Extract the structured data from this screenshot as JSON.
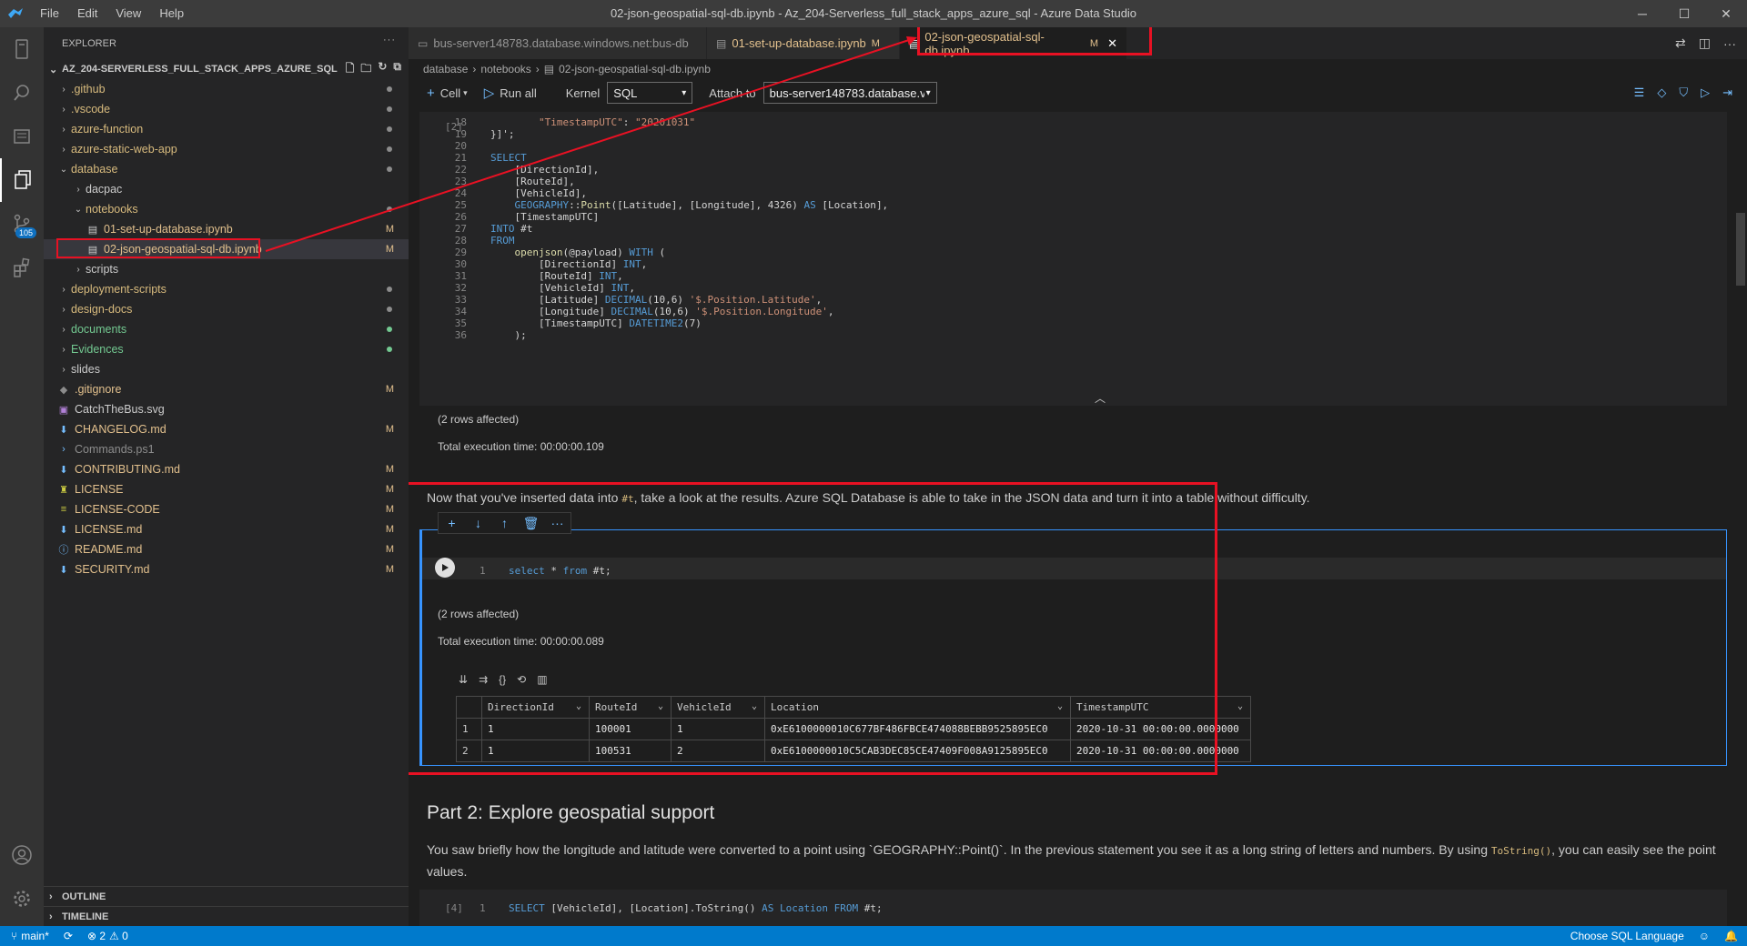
{
  "window": {
    "title": "02-json-geospatial-sql-db.ipynb - Az_204-Serverless_full_stack_apps_azure_sql - Azure Data Studio",
    "menu": [
      "File",
      "Edit",
      "View",
      "Help"
    ],
    "controls": {
      "minimize": "─",
      "maximize": "☐",
      "close": "✕"
    }
  },
  "activity_bar": {
    "items": [
      "connections-icon",
      "search-icon",
      "notebooks-icon",
      "explorer-icon",
      "source-control-icon",
      "extensions-icon",
      "account-icon",
      "settings-icon"
    ],
    "scm_badge": "105"
  },
  "sidebar": {
    "header": "EXPLORER",
    "more": "···",
    "root": "AZ_204-SERVERLESS_FULL_STACK_APPS_AZURE_SQL",
    "items": [
      {
        "label": ".github",
        "status": "dot"
      },
      {
        "label": ".vscode",
        "status": "dot"
      },
      {
        "label": "azure-function",
        "status": "dot"
      },
      {
        "label": "azure-static-web-app",
        "status": "dot"
      },
      {
        "label": "database",
        "status": "dot"
      },
      {
        "label": "dacpac",
        "status": ""
      },
      {
        "label": "notebooks",
        "status": "dot"
      },
      {
        "label": "01-set-up-database.ipynb",
        "status": "M"
      },
      {
        "label": "02-json-geospatial-sql-db.ipynb",
        "status": "M"
      },
      {
        "label": "scripts",
        "status": ""
      },
      {
        "label": "deployment-scripts",
        "status": "dot"
      },
      {
        "label": "design-docs",
        "status": "dot"
      },
      {
        "label": "documents",
        "status": "dot"
      },
      {
        "label": "Evidences",
        "status": "dot"
      },
      {
        "label": "slides",
        "status": ""
      },
      {
        "label": ".gitignore",
        "status": "M"
      },
      {
        "label": "CatchTheBus.svg",
        "status": ""
      },
      {
        "label": "CHANGELOG.md",
        "status": "M"
      },
      {
        "label": "Commands.ps1",
        "status": ""
      },
      {
        "label": "CONTRIBUTING.md",
        "status": "M"
      },
      {
        "label": "LICENSE",
        "status": "M"
      },
      {
        "label": "LICENSE-CODE",
        "status": "M"
      },
      {
        "label": "LICENSE.md",
        "status": "M"
      },
      {
        "label": "README.md",
        "status": "M"
      },
      {
        "label": "SECURITY.md",
        "status": "M"
      }
    ],
    "outline": "OUTLINE",
    "timeline": "TIMELINE"
  },
  "tabs": [
    {
      "label": "bus-server148783.database.windows.net:bus-db",
      "modified": ""
    },
    {
      "label": "01-set-up-database.ipynb",
      "modified": "M"
    },
    {
      "label": "02-json-geospatial-sql-db.ipynb",
      "modified": "M",
      "close": "✕"
    }
  ],
  "breadcrumb": [
    "database",
    "notebooks",
    "02-json-geospatial-sql-db.ipynb"
  ],
  "notebook_toolbar": {
    "cell": "Cell",
    "run_all": "Run all",
    "kernel_label": "Kernel",
    "kernel_value": "SQL",
    "attach_label": "Attach to",
    "attach_value": "bus-server148783.database.v"
  },
  "cell1": {
    "exec_count": "[2]",
    "lines": [
      {
        "n": "18",
        "text": "        \"TimestampUTC\": \"20201031\""
      },
      {
        "n": "19",
        "text": "}]';"
      },
      {
        "n": "20",
        "text": ""
      },
      {
        "n": "21",
        "text": "SELECT"
      },
      {
        "n": "22",
        "text": "    [DirectionId],"
      },
      {
        "n": "23",
        "text": "    [RouteId],"
      },
      {
        "n": "24",
        "text": "    [VehicleId],"
      },
      {
        "n": "25",
        "text": "    GEOGRAPHY::Point([Latitude], [Longitude], 4326) AS [Location],"
      },
      {
        "n": "26",
        "text": "    [TimestampUTC]"
      },
      {
        "n": "27",
        "text": "INTO #t"
      },
      {
        "n": "28",
        "text": "FROM"
      },
      {
        "n": "29",
        "text": "    openjson(@payload) WITH ("
      },
      {
        "n": "30",
        "text": "        [DirectionId] INT,"
      },
      {
        "n": "31",
        "text": "        [RouteId] INT,"
      },
      {
        "n": "32",
        "text": "        [VehicleId] INT,"
      },
      {
        "n": "33",
        "text": "        [Latitude] DECIMAL(10,6) '$.Position.Latitude',"
      },
      {
        "n": "34",
        "text": "        [Longitude] DECIMAL(10,6) '$.Position.Longitude',"
      },
      {
        "n": "35",
        "text": "        [TimestampUTC] DATETIME2(7)"
      },
      {
        "n": "36",
        "text": "    );"
      }
    ],
    "output_rows": "(2 rows affected)",
    "output_time": "Total execution time: 00:00:00.109"
  },
  "markdown1": {
    "before": "Now that you've inserted data into ",
    "code": "#t",
    "after": ", take a look at the results. Azure SQL Database is able to take in the JSON data and turn it into a table without difficulty."
  },
  "cell2": {
    "line_no": "1",
    "code_kw1": "select",
    "code_mid": " * ",
    "code_kw2": "from",
    "code_end": " #t;",
    "output_rows": "(2 rows affected)",
    "output_time": "Total execution time: 00:00:00.089",
    "grid": {
      "columns": [
        "DirectionId",
        "RouteId",
        "VehicleId",
        "Location",
        "TimestampUTC"
      ],
      "rows": [
        [
          "1",
          "1",
          "100001",
          "1",
          "0xE6100000010C677BF486FBCE474088BEBB9525895EC0",
          "2020-10-31 00:00:00.0000000"
        ],
        [
          "2",
          "1",
          "100531",
          "2",
          "0xE6100000010C5CAB3DEC85CE47409F008A9125895EC0",
          "2020-10-31 00:00:00.0000000"
        ]
      ]
    }
  },
  "markdown2": {
    "heading": "Part 2: Explore geospatial support",
    "para_before": "You saw briefly how the longitude and latitude were converted to a point using `GEOGRAPHY::Point()`. In the previous statement you see it as a long string of letters and numbers. By using ",
    "para_code": "ToString()",
    "para_after": ", you can easily see the point values."
  },
  "cell3": {
    "exec_count": "[4]",
    "line_no": "1",
    "kw1": "SELECT",
    "mid1": " [VehicleId], [Location].ToString() ",
    "kw2": "AS Location FROM",
    "end": " #t;"
  },
  "statusbar": {
    "branch": "main*",
    "sync": "⟳",
    "errors": "⊗ 2",
    "warnings": "⚠ 0",
    "language": "Choose SQL Language"
  },
  "colors": {
    "accent": "#007acc",
    "highlight_box": "#e81123",
    "modified": "#e2c08d"
  }
}
